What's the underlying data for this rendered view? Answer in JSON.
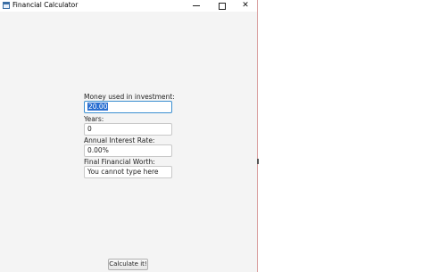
{
  "window": {
    "title": "Financial Calculator"
  },
  "form": {
    "investment_label": "Money used in investment:",
    "investment_value": "20.00",
    "years_label": "Years:",
    "years_value": "0",
    "rate_label": "Annual Interest Rate:",
    "rate_value": "0.00%",
    "final_label": "Final Financial Worth:",
    "final_value": "You cannot type here"
  },
  "actions": {
    "calculate_label": "Calculate it!"
  },
  "icons": {
    "app": "app-window-icon",
    "minimize": "minimize-icon",
    "maximize": "maximize-icon",
    "close": "close-icon"
  },
  "colors": {
    "focus_border": "#3b8fd0",
    "selection": "#2a6fd1",
    "window_bg": "#f4f4f4"
  }
}
